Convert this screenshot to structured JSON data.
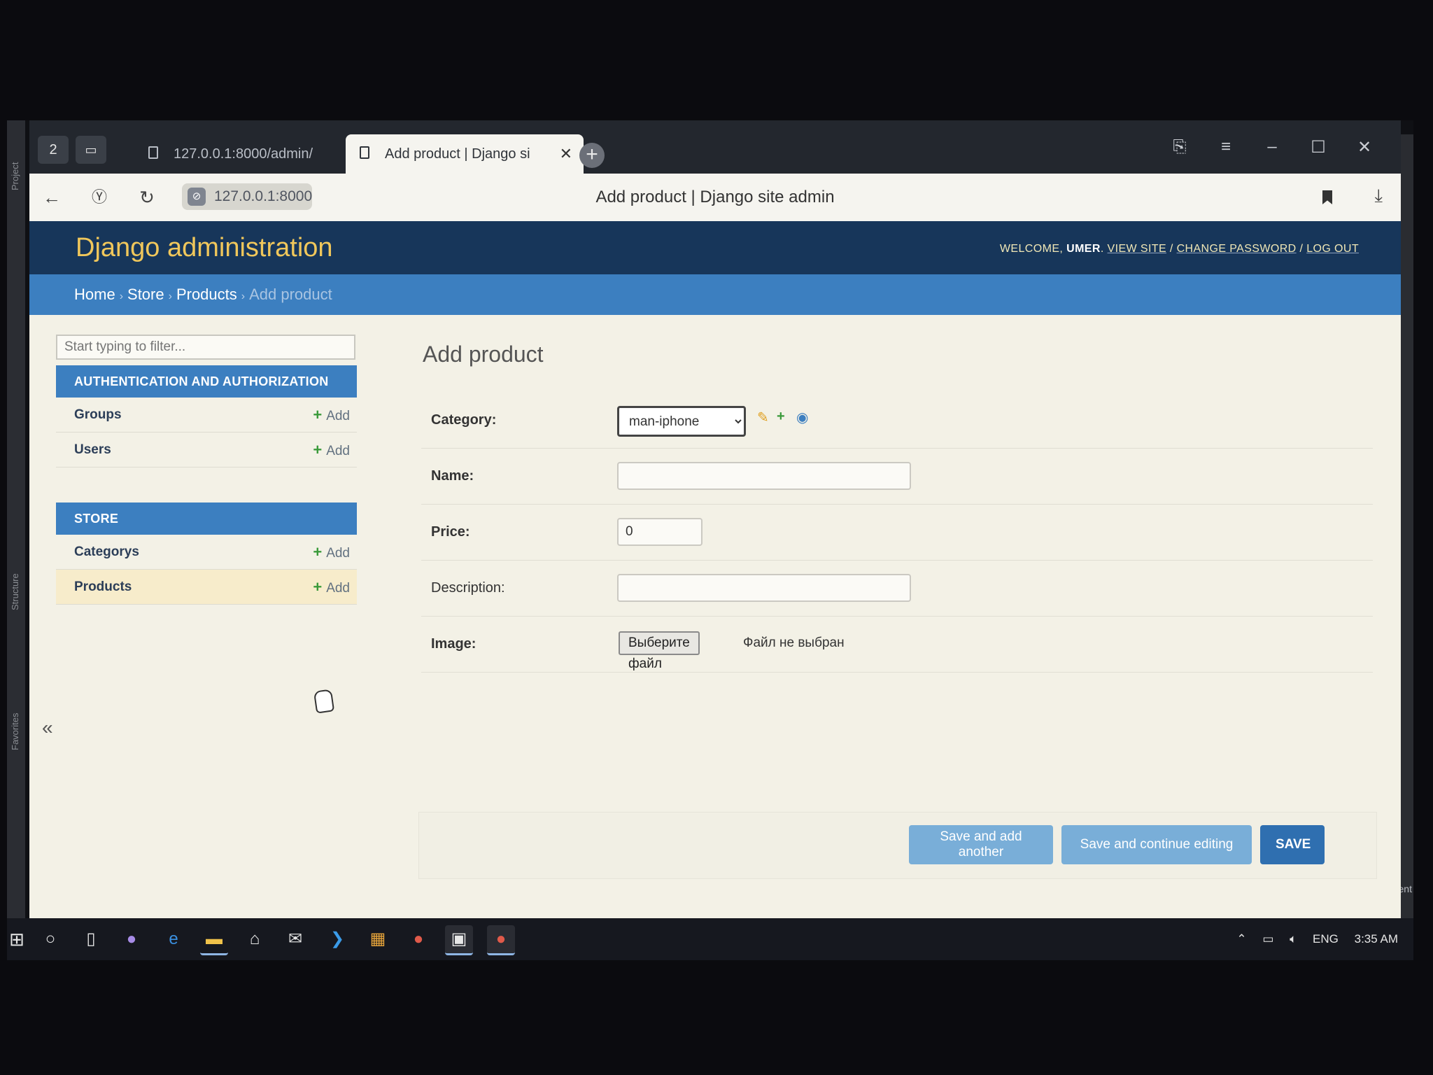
{
  "ide": {
    "left_labels": [
      "Project",
      "Structure",
      "Favorites"
    ],
    "right_label": "Event"
  },
  "browser": {
    "tab_counter": "2",
    "tabs": [
      {
        "label": "127.0.0.1:8000/admin/"
      },
      {
        "label": "Add product | Django si"
      }
    ],
    "url": "127.0.0.1:8000",
    "page_title": "Add product | Django site admin"
  },
  "header": {
    "branding": "Django administration",
    "welcome": "Welcome,",
    "user": "UMER",
    "view_site": "View site",
    "change_password": "Change password",
    "log_out": "Log out"
  },
  "breadcrumbs": {
    "home": "Home",
    "app": "Store",
    "model": "Products",
    "current": "Add product"
  },
  "sidebar": {
    "filter_placeholder": "Start typing to filter...",
    "add_label": "Add",
    "modules": [
      {
        "caption": "AUTHENTICATION AND AUTHORIZATION",
        "models": [
          "Groups",
          "Users"
        ]
      },
      {
        "caption": "STORE",
        "models": [
          "Categorys",
          "Products"
        ]
      }
    ],
    "collapse": "«"
  },
  "content": {
    "title": "Add product",
    "fields": {
      "category": {
        "label": "Category:",
        "value": "man-iphone"
      },
      "name": {
        "label": "Name:",
        "value": ""
      },
      "price": {
        "label": "Price:",
        "value": "0"
      },
      "description": {
        "label": "Description:",
        "value": ""
      },
      "image": {
        "label": "Image:",
        "button": "Выберите файл",
        "status": "Файл не выбран"
      }
    },
    "buttons": {
      "save_add_another": "Save and add another",
      "save_continue": "Save and continue editing",
      "save": "SAVE"
    }
  },
  "taskbar": {
    "language": "ENG",
    "time": "3:35 AM"
  },
  "colors": {
    "header_bg": "#17365a",
    "branding": "#f0c75b",
    "breadcrumbs_bg": "#3c7fc0",
    "module_caption_bg": "#3c7fc0",
    "current_model_bg": "#f7eccb",
    "save_button": "#2f6fb0",
    "secondary_button": "#79aed8"
  }
}
